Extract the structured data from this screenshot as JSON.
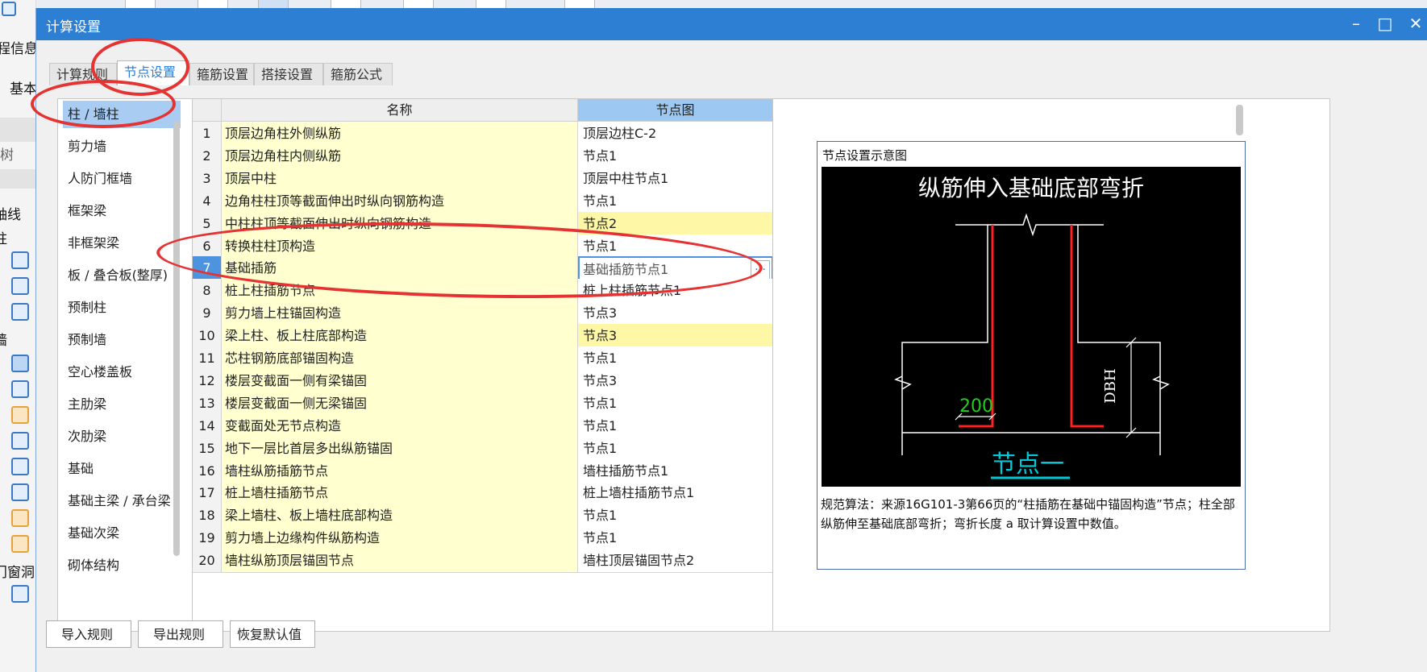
{
  "background": {
    "left_texts": [
      "程信息",
      "基本",
      "树",
      "轴线",
      "柱",
      "墙",
      "门窗洞"
    ]
  },
  "dialog": {
    "title": "计算设置",
    "controls": {
      "minimize": "–",
      "maximize": "□",
      "close": "✕"
    },
    "tabs": [
      {
        "label": "计算规则",
        "active": false
      },
      {
        "label": "节点设置",
        "active": true
      },
      {
        "label": "箍筋设置",
        "active": false
      },
      {
        "label": "搭接设置",
        "active": false
      },
      {
        "label": "箍筋公式",
        "active": false
      }
    ],
    "categories": [
      {
        "label": "柱 / 墙柱",
        "active": true
      },
      {
        "label": "剪力墙"
      },
      {
        "label": "人防门框墙"
      },
      {
        "label": "框架梁"
      },
      {
        "label": "非框架梁"
      },
      {
        "label": "板 / 叠合板(整厚)"
      },
      {
        "label": "预制柱"
      },
      {
        "label": "预制墙"
      },
      {
        "label": "空心楼盖板"
      },
      {
        "label": "主肋梁"
      },
      {
        "label": "次肋梁"
      },
      {
        "label": "基础"
      },
      {
        "label": "基础主梁 / 承台梁"
      },
      {
        "label": "基础次梁"
      },
      {
        "label": "砌体结构"
      }
    ],
    "table": {
      "headers": {
        "name": "名称",
        "node": "节点图"
      },
      "rows": [
        {
          "index": "1",
          "name": "顶层边角柱外侧纵筋",
          "node": "顶层边柱C-2"
        },
        {
          "index": "2",
          "name": "顶层边角柱内侧纵筋",
          "node": "节点1"
        },
        {
          "index": "3",
          "name": "顶层中柱",
          "node": "顶层中柱节点1"
        },
        {
          "index": "4",
          "name": "边角柱柱顶等截面伸出时纵向钢筋构造",
          "node": "节点1"
        },
        {
          "index": "5",
          "name": "中柱柱顶等截面伸出时纵向钢筋构造",
          "node": "节点2",
          "highlight": true
        },
        {
          "index": "6",
          "name": "转换柱柱顶构造",
          "node": "节点1"
        },
        {
          "index": "7",
          "name": "基础插筋",
          "node": "基础插筋节点1",
          "selected": true
        },
        {
          "index": "8",
          "name": "桩上柱插筋节点",
          "node": "桩上柱插筋节点1"
        },
        {
          "index": "9",
          "name": "剪力墙上柱锚固构造",
          "node": "节点3"
        },
        {
          "index": "10",
          "name": "梁上柱、板上柱底部构造",
          "node": "节点3",
          "highlight": true
        },
        {
          "index": "11",
          "name": "芯柱钢筋底部锚固构造",
          "node": "节点1"
        },
        {
          "index": "12",
          "name": "楼层变截面一侧有梁锚固",
          "node": "节点3"
        },
        {
          "index": "13",
          "name": "楼层变截面一侧无梁锚固",
          "node": "节点1"
        },
        {
          "index": "14",
          "name": "变截面处无节点构造",
          "node": "节点1"
        },
        {
          "index": "15",
          "name": "地下一层比首层多出纵筋锚固",
          "node": "节点1"
        },
        {
          "index": "16",
          "name": "墙柱纵筋插筋节点",
          "node": "墙柱插筋节点1"
        },
        {
          "index": "17",
          "name": "桩上墙柱插筋节点",
          "node": "桩上墙柱插筋节点1"
        },
        {
          "index": "18",
          "name": "梁上墙柱、板上墙柱底部构造",
          "node": "节点1"
        },
        {
          "index": "19",
          "name": "剪力墙上边缘构件纵筋构造",
          "node": "节点1"
        },
        {
          "index": "20",
          "name": "墙柱纵筋顶层锚固节点",
          "node": "墙柱顶层锚固节点2"
        }
      ]
    },
    "preview": {
      "title": "节点设置示意图",
      "diagram_heading": "纵筋伸入基础底部弯折",
      "diagram_label_dbh": "DBH",
      "diagram_label_200": "200",
      "diagram_caption": "节点一",
      "description": "规范算法：来源16G101-3第66页的“柱插筋在基础中锚固构造”节点；柱全部纵筋伸至基础底部弯折；弯折长度 a 取计算设置中数值。"
    },
    "buttons": {
      "import": "导入规则",
      "export": "导出规则",
      "restore": "恢复默认值"
    }
  },
  "colors": {
    "titlebar": "#2d7fd3",
    "active_tab_text": "#2d7fd3",
    "name_cell": "#ffffcf",
    "highlight_cell": "#fdf7a6",
    "annotation_red": "#e53232",
    "rebar_red": "#ff2020",
    "dim_green": "#22cc22",
    "caption_cyan": "#00c8d8"
  }
}
